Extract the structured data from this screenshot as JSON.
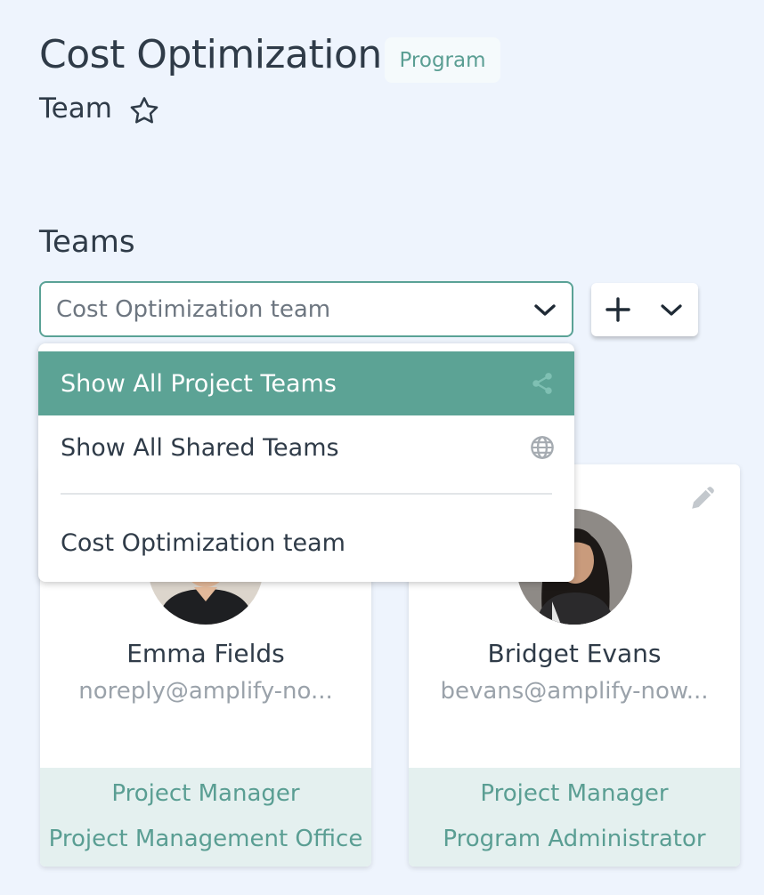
{
  "header": {
    "title": "Cost Optimization",
    "badge": "Program",
    "subtitle": "Team"
  },
  "teams": {
    "label": "Teams",
    "selected": "Cost Optimization team"
  },
  "dropdown": {
    "items": [
      {
        "label": "Show All Project Teams",
        "icon": "share-icon",
        "active": true
      },
      {
        "label": "Show All Shared Teams",
        "icon": "globe-icon",
        "active": false
      },
      {
        "label": "Cost Optimization team",
        "icon": "",
        "active": false
      }
    ]
  },
  "members": [
    {
      "name": "Emma Fields",
      "email": "noreply@amplify-no...",
      "role": "Project Manager",
      "department": "Project Management Office"
    },
    {
      "name": "Bridget Evans",
      "email": "bevans@amplify-now...",
      "role": "Project Manager",
      "department": "Program Administrator"
    }
  ],
  "colors": {
    "accent": "#5ca395",
    "background": "#eef4fd",
    "text": "#2f3b48"
  }
}
